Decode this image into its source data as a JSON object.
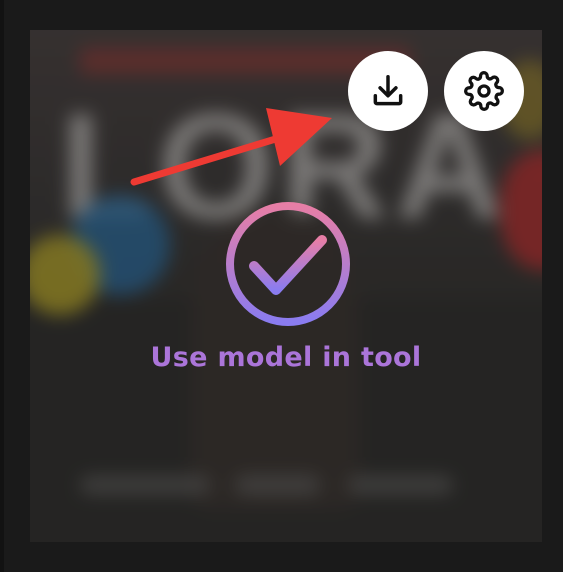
{
  "card": {
    "action_label": "Use model in tool"
  },
  "icons": {
    "download": "download-icon",
    "settings": "gear-icon",
    "check": "check-circle-icon",
    "arrow": "red-arrow-annotation"
  },
  "colors": {
    "action_text": "#ab75d9",
    "gradient_top": "#e77ea6",
    "gradient_bottom": "#8a7cf0",
    "arrow": "#ee3a33",
    "button_bg": "#ffffff"
  }
}
